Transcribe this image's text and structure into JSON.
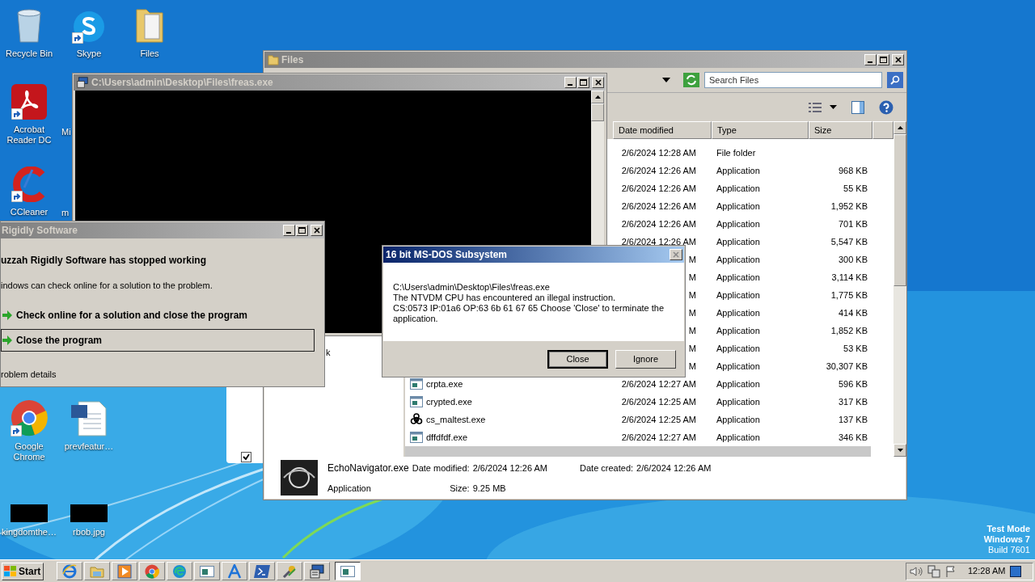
{
  "desktop_icons": [
    {
      "label": "Recycle Bin",
      "kind": "recycle-bin",
      "shortcut": false
    },
    {
      "label": "Skype",
      "kind": "skype",
      "shortcut": true
    },
    {
      "label": "Files",
      "kind": "folder",
      "shortcut": false
    },
    {
      "label": "Acrobat Reader DC",
      "kind": "acrobat",
      "shortcut": true
    },
    {
      "label": "Mi",
      "kind": "hidden"
    },
    {
      "label": "CCleaner",
      "kind": "ccleaner",
      "shortcut": true
    },
    {
      "label": "m",
      "kind": "hidden"
    },
    {
      "label": "Google Chrome",
      "kind": "chrome",
      "shortcut": true
    },
    {
      "label": "prevfeatur…",
      "kind": "word",
      "shortcut": false
    },
    {
      "label": "kingdomthe…",
      "kind": "thumbnail",
      "shortcut": false
    },
    {
      "label": "rbob.jpg",
      "kind": "thumbnail",
      "shortcut": false
    }
  ],
  "explorer": {
    "title": "Files",
    "search_placeholder": "Search Files",
    "nav_item": "k",
    "columns": [
      "Date modified",
      "Type",
      "Size"
    ],
    "rows": [
      {
        "date": "2/6/2024 12:28 AM",
        "type": "File folder",
        "selected": false
      },
      {
        "date": "2/6/2024 12:26 AM",
        "type": "Application",
        "size": "968 KB",
        "selected": false
      },
      {
        "date": "2/6/2024 12:26 AM",
        "type": "Application",
        "size": "55 KB",
        "selected": false
      },
      {
        "date": "2/6/2024 12:26 AM",
        "type": "Application",
        "size": "1,952 KB",
        "selected": false
      },
      {
        "date": "2/6/2024 12:26 AM",
        "type": "Application",
        "size": "701 KB",
        "selected": false
      },
      {
        "date": "2/6/2024 12:26 AM",
        "type": "Application",
        "size": "5,547 KB",
        "selected": false
      },
      {
        "date": "M",
        "type": "Application",
        "size": "300 KB",
        "selected": false
      },
      {
        "date": "M",
        "type": "Application",
        "size": "3,114 KB",
        "selected": false
      },
      {
        "date": "M",
        "type": "Application",
        "size": "1,775 KB",
        "selected": false
      },
      {
        "date": "M",
        "type": "Application",
        "size": "414 KB",
        "selected": false
      },
      {
        "date": "M",
        "type": "Application",
        "size": "1,852 KB",
        "selected": false
      },
      {
        "date": "M",
        "type": "Application",
        "size": "53 KB",
        "selected": false
      },
      {
        "date": "M",
        "type": "Application",
        "size": "30,307 KB",
        "selected": false
      },
      {
        "name": "crpta.exe",
        "kind": "app",
        "date": "2/6/2024 12:27 AM",
        "type": "Application",
        "size": "596 KB",
        "selected": false
      },
      {
        "name": "crypted.exe",
        "kind": "app",
        "date": "2/6/2024 12:25 AM",
        "type": "Application",
        "size": "317 KB",
        "selected": false
      },
      {
        "name": "cs_maltest.exe",
        "kind": "biohazard",
        "date": "2/6/2024 12:25 AM",
        "type": "Application",
        "size": "137 KB",
        "selected": false
      },
      {
        "name": "dffdfdf.exe",
        "kind": "app",
        "date": "2/6/2024 12:27 AM",
        "type": "Application",
        "size": "346 KB",
        "selected": false
      },
      {
        "selected": true
      }
    ],
    "details": {
      "name": "EchoNavigator.exe",
      "type": "Application",
      "modified_label": "Date modified:",
      "modified": "2/6/2024 12:26 AM",
      "size_label": "Size:",
      "size": "9.25 MB",
      "created_label": "Date created:",
      "created": "2/6/2024 12:26 AM"
    }
  },
  "back_panel": {
    "checked": true
  },
  "console": {
    "title": "C:\\Users\\admin\\Desktop\\Files\\freas.exe"
  },
  "crash_dialog": {
    "title": "Rigidly Software",
    "heading": "uzzah Rigidly Software has stopped working",
    "subtext": "indows can check online for a solution to the problem.",
    "options": [
      {
        "label": "Check online for a solution and close the program",
        "selected": false
      },
      {
        "label": "Close the program",
        "selected": true
      }
    ],
    "details_link": "roblem details"
  },
  "dos_dialog": {
    "title": "16 bit MS-DOS Subsystem",
    "lines": [
      "C:\\Users\\admin\\Desktop\\Files\\freas.exe",
      "The NTVDM CPU has encountered an illegal instruction.",
      "CS:0573 IP:01a6 OP:63 6b 61 67 65 Choose 'Close' to terminate the application."
    ],
    "buttons": [
      {
        "label": "Close",
        "default": true
      },
      {
        "label": "Ignore",
        "default": false
      }
    ]
  },
  "test_mode": [
    "Test Mode",
    "Windows 7",
    "Build 7601"
  ],
  "taskbar": {
    "start": "Start",
    "apps": [
      {
        "kind": "ie",
        "selected": false
      },
      {
        "kind": "explorer",
        "selected": false
      },
      {
        "kind": "media",
        "selected": false
      },
      {
        "kind": "chrome",
        "selected": false
      },
      {
        "kind": "edge",
        "selected": false
      },
      {
        "kind": "window",
        "selected": false
      },
      {
        "kind": "letter",
        "selected": false
      },
      {
        "kind": "powershell",
        "selected": false
      },
      {
        "kind": "tool",
        "selected": false
      },
      {
        "kind": "dos",
        "selected": false
      },
      {
        "kind": "window",
        "selected": true
      }
    ],
    "time": "12:28 AM"
  }
}
